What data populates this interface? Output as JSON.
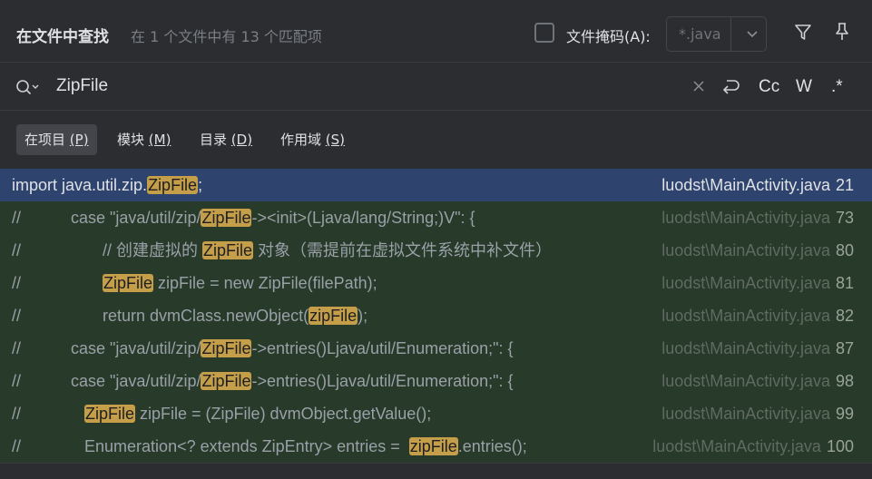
{
  "header": {
    "title": "在文件中查找",
    "summary": "在 1 个文件中有 13 个匹配项",
    "file_mask_label": "文件掩码(A):",
    "file_mask_value": "*.java",
    "file_mask_checked": false
  },
  "search": {
    "query": "ZipFile",
    "options": {
      "match_case": "Cc",
      "words": "W",
      "regex": ".*"
    }
  },
  "scopes": [
    {
      "label": "在项目",
      "mnemonic": "(P)",
      "active": true
    },
    {
      "label": "模块",
      "mnemonic": "(M)",
      "active": false
    },
    {
      "label": "目录",
      "mnemonic": "(D)",
      "active": false
    },
    {
      "label": "作用域",
      "mnemonic": "(S)",
      "active": false
    }
  ],
  "results": [
    {
      "selected": true,
      "segments": [
        {
          "t": "import java.util.zip."
        },
        {
          "t": "ZipFile",
          "hl": true
        },
        {
          "t": ";"
        }
      ],
      "file": "luodst\\MainActivity.java",
      "line": "21"
    },
    {
      "selected": false,
      "segments": [
        {
          "t": "//           case \"java/util/zip/"
        },
        {
          "t": "ZipFile",
          "hl": true
        },
        {
          "t": "-><init>(Ljava/lang/String;)V\": {"
        }
      ],
      "file": "luodst\\MainActivity.java",
      "line": "73"
    },
    {
      "selected": false,
      "segments": [
        {
          "t": "//                  // 创建虚拟的 "
        },
        {
          "t": "ZipFile",
          "hl": true
        },
        {
          "t": " 对象（需提前在虚拟文件系统中补文件）"
        }
      ],
      "file": "luodst\\MainActivity.java",
      "line": "80"
    },
    {
      "selected": false,
      "segments": [
        {
          "t": "//                  "
        },
        {
          "t": "ZipFile",
          "hl": true
        },
        {
          "t": " zipFile = new ZipFile(filePath);"
        }
      ],
      "file": "luodst\\MainActivity.java",
      "line": "81"
    },
    {
      "selected": false,
      "segments": [
        {
          "t": "//                  return dvmClass.newObject("
        },
        {
          "t": "zipFile",
          "hl": true
        },
        {
          "t": ");"
        }
      ],
      "file": "luodst\\MainActivity.java",
      "line": "82"
    },
    {
      "selected": false,
      "segments": [
        {
          "t": "//           case \"java/util/zip/"
        },
        {
          "t": "ZipFile",
          "hl": true
        },
        {
          "t": "->entries()Ljava/util/Enumeration;\": {"
        }
      ],
      "file": "luodst\\MainActivity.java",
      "line": "87"
    },
    {
      "selected": false,
      "segments": [
        {
          "t": "//           case \"java/util/zip/"
        },
        {
          "t": "ZipFile",
          "hl": true
        },
        {
          "t": "->entries()Ljava/util/Enumeration;\": {"
        }
      ],
      "file": "luodst\\MainActivity.java",
      "line": "98"
    },
    {
      "selected": false,
      "segments": [
        {
          "t": "//              "
        },
        {
          "t": "ZipFile",
          "hl": true
        },
        {
          "t": " zipFile = (ZipFile) dvmObject.getValue();"
        }
      ],
      "file": "luodst\\MainActivity.java",
      "line": "99"
    },
    {
      "selected": false,
      "segments": [
        {
          "t": "//              Enumeration<? extends ZipEntry> entries =  "
        },
        {
          "t": "zipFile",
          "hl": true
        },
        {
          "t": ".entries();"
        }
      ],
      "file": "luodst\\MainActivity.java",
      "line": "100"
    }
  ],
  "colors": {
    "background": "#2b2d30",
    "selected_row": "#2e436e",
    "result_row": "#283a29",
    "match_highlight": "#c59e49"
  }
}
